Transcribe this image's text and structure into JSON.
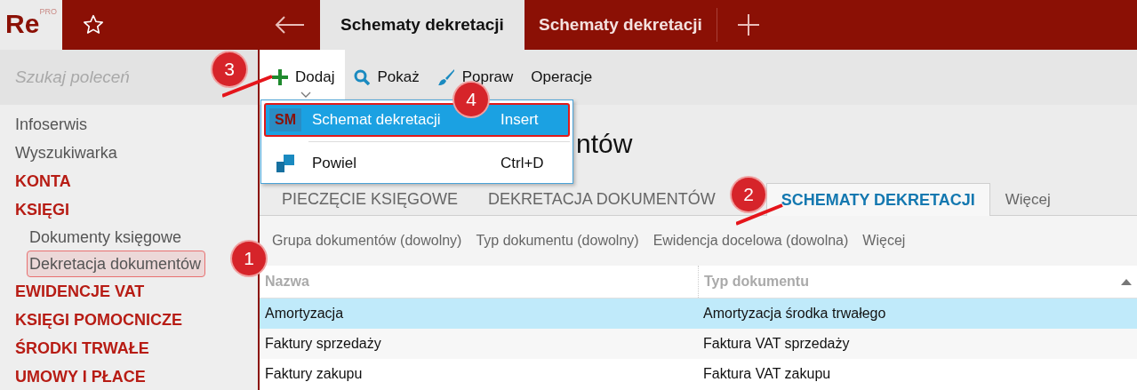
{
  "logo": {
    "text": "Re",
    "superscript": "PRO"
  },
  "tabs": [
    {
      "label": "Schematy dekretacji",
      "selected": true
    },
    {
      "label": "Schematy dekretacji",
      "selected": false
    }
  ],
  "search": {
    "placeholder": "Szukaj poleceń"
  },
  "sidebar": {
    "items": [
      {
        "label": "Infoserwis",
        "kind": "link"
      },
      {
        "label": "Wyszukiwarka",
        "kind": "link"
      },
      {
        "label": "KONTA",
        "kind": "section"
      },
      {
        "label": "KSIĘGI",
        "kind": "section",
        "children": [
          {
            "label": "Dokumenty księgowe",
            "highlighted": false
          },
          {
            "label": "Dekretacja dokumentów",
            "highlighted": true
          }
        ]
      },
      {
        "label": "EWIDENCJE VAT",
        "kind": "section"
      },
      {
        "label": "KSIĘGI POMOCNICZE",
        "kind": "section"
      },
      {
        "label": "ŚRODKI TRWAŁE",
        "kind": "section"
      },
      {
        "label": "UMOWY I PŁACE",
        "kind": "section"
      }
    ]
  },
  "toolbar": [
    {
      "label": "Dodaj",
      "dropdown": true
    },
    {
      "label": "Pokaż",
      "dropdown": false
    },
    {
      "label": "Popraw",
      "dropdown": false
    },
    {
      "label": "Operacje",
      "dropdown": false
    }
  ],
  "menu": {
    "items": [
      {
        "label": "Schemat dekretacji",
        "badge": "SM",
        "shortcut": "Insert",
        "selected": true
      },
      {
        "label": "Powiel",
        "shortcut": "Ctrl+D",
        "selected": false
      }
    ]
  },
  "heading": "ntów",
  "section_tabs": [
    {
      "label": "PIECZĘCIE KSIĘGOWE",
      "selected": false
    },
    {
      "label": "DEKRETACJA DOKUMENTÓW",
      "selected": false
    },
    {
      "label": "SCHEMATY DEKRETACJI",
      "selected": true
    },
    {
      "label": "Więcej",
      "selected": false
    }
  ],
  "filters": [
    "Grupa dokumentów (dowolny)",
    "Typ dokumentu (dowolny)",
    "Ewidencja docelowa (dowolna)",
    "Więcej"
  ],
  "table": {
    "columns": [
      "Nazwa",
      "Typ dokumentu"
    ],
    "rows": [
      {
        "cells": [
          "Amortyzacja",
          "Amortyzacja środka trwałego"
        ],
        "selected": true
      },
      {
        "cells": [
          "Faktury sprzedaży",
          "Faktura VAT sprzedaży"
        ],
        "selected": false
      },
      {
        "cells": [
          "Faktury zakupu",
          "Faktura VAT zakupu"
        ],
        "selected": false
      }
    ]
  },
  "callouts": [
    {
      "number": "1",
      "arrow": false
    },
    {
      "number": "2",
      "arrow": true
    },
    {
      "number": "3",
      "arrow": true
    },
    {
      "number": "4",
      "arrow": false
    }
  ]
}
